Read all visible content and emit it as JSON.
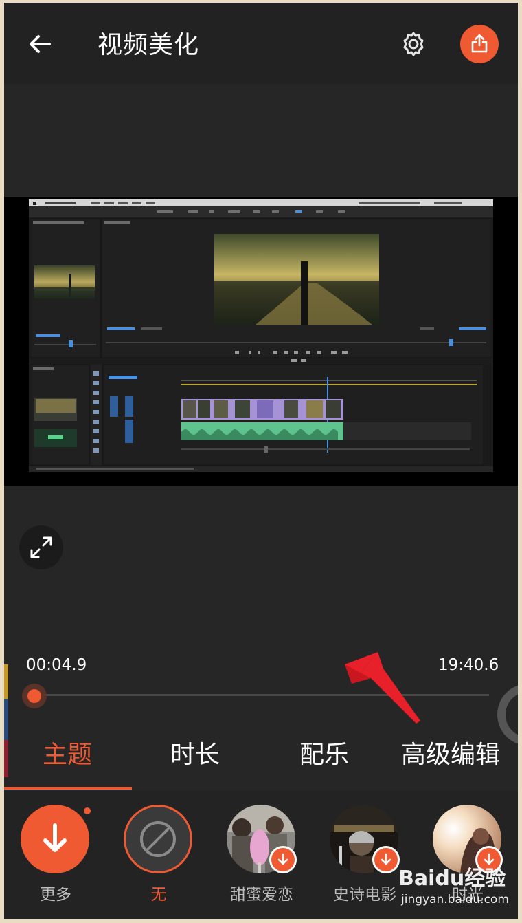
{
  "header": {
    "title": "视频美化",
    "back_icon": "arrow-left-icon",
    "settings_icon": "gear-icon",
    "share_icon": "share-upload-icon"
  },
  "preview": {
    "expand_icon": "expand-diagonal-icon"
  },
  "timeline": {
    "current_time": "00:04.9",
    "total_time": "19:40.6",
    "progress_fraction": 0.004
  },
  "tabs": [
    {
      "label": "主题",
      "active": true
    },
    {
      "label": "时长",
      "active": false
    },
    {
      "label": "配乐",
      "active": false
    },
    {
      "label": "高级编辑",
      "active": false
    }
  ],
  "themes": [
    {
      "label": "更多",
      "icon": "download-icon",
      "notify": true
    },
    {
      "label": "无",
      "icon": "none-slash-icon",
      "selected": true
    },
    {
      "label": "甜蜜爱恋",
      "icon": "download-icon"
    },
    {
      "label": "史诗电影",
      "icon": "download-icon"
    },
    {
      "label": "时光",
      "icon": "download-icon"
    }
  ],
  "watermark": {
    "brand": "Baidu经验",
    "url": "jingyan.baidu.com"
  },
  "colors": {
    "accent": "#ef5a32",
    "background": "#262626",
    "topbar": "#222222",
    "annotation_arrow": "#e8202a"
  }
}
